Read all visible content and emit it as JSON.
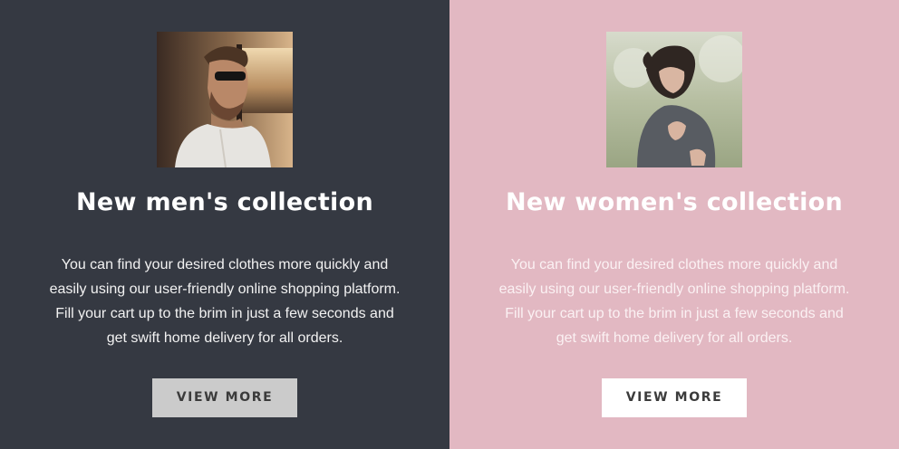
{
  "men": {
    "title": "New men's collection",
    "description": "You can find your desired clothes more quickly and easily using our user-friendly online shopping platform. Fill your cart up to the brim in just a few seconds and get swift home delivery for all orders.",
    "button_label": "VIEW MORE",
    "background": "#353942"
  },
  "women": {
    "title": "New women's collection",
    "description": "You can find your desired clothes more quickly and easily using our user-friendly online shopping platform. Fill your cart up to the brim in just a few seconds and get swift home delivery for all orders.",
    "button_label": "VIEW MORE",
    "background": "#e2b8c2"
  }
}
